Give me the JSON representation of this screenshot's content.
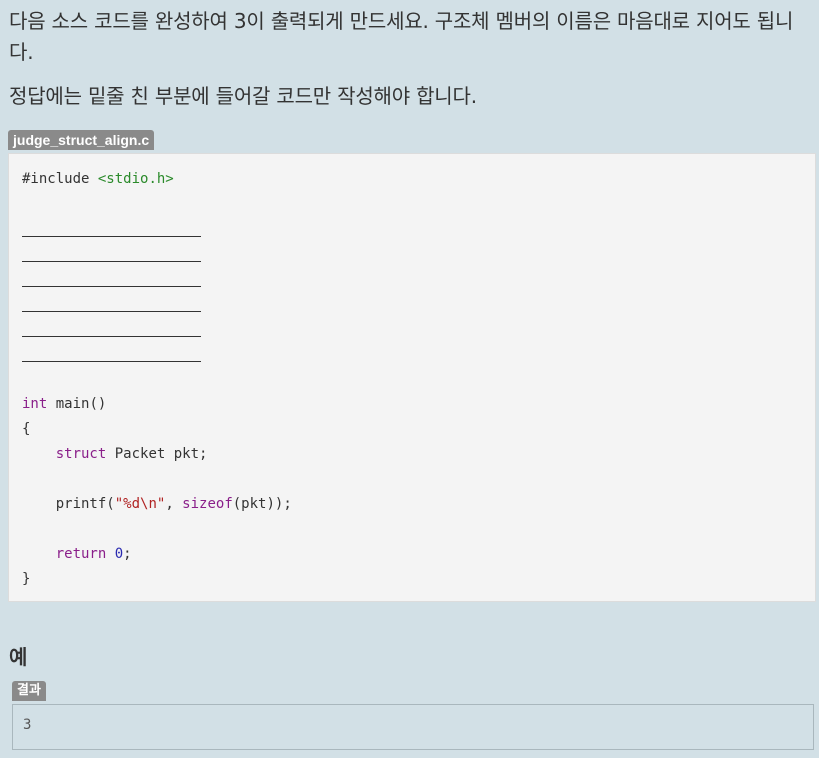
{
  "question": {
    "line1": "다음 소스 코드를 완성하여 3이 출력되게 만드세요. 구조체 멤버의 이름은 마음대로 지어도 됩니다.",
    "line2": "정답에는 밑줄 친 부분에 들어갈 코드만 작성해야 합니다."
  },
  "code": {
    "filename": "judge_struct_align.c",
    "include_directive": "#include",
    "include_header": "<stdio.h>",
    "blank_count": 6,
    "main_type": "int",
    "main_sig": " main()",
    "open_brace": "{",
    "struct_kw": "struct",
    "struct_decl": " Packet pkt;",
    "printf_open": "printf(",
    "printf_fmt": "\"%d\\n\"",
    "printf_sep": ", ",
    "sizeof_kw": "sizeof",
    "printf_close": "(pkt));",
    "return_kw": "return",
    "return_val": "0",
    "return_end": ";",
    "close_brace": "}"
  },
  "example": {
    "title": "예",
    "result_label": "결과",
    "result_value": "3"
  },
  "colors": {
    "page_bg": "#d2e0e6",
    "code_bg": "#f4f4f4",
    "keyword": "#8a1f8a",
    "string": "#b02222",
    "include_header": "#2a8a2a",
    "number": "#2a2ab0",
    "tag_bg": "#8a8a8a"
  }
}
